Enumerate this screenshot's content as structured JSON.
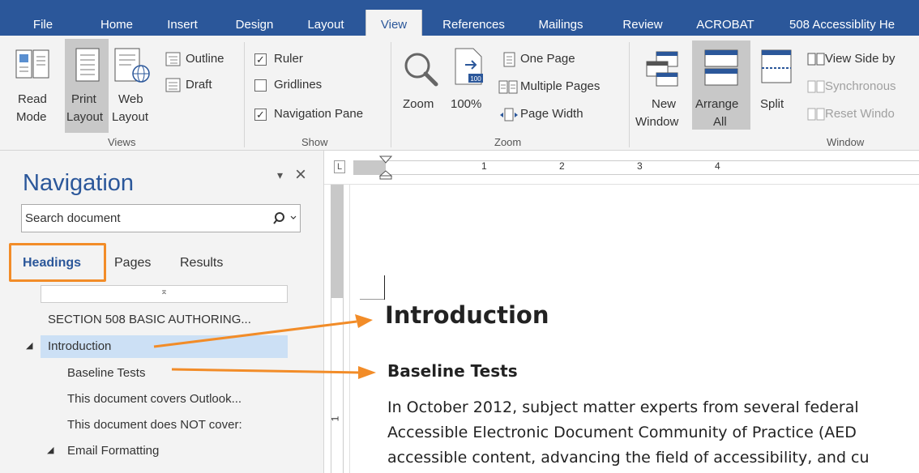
{
  "tabs": [
    "File",
    "Home",
    "Insert",
    "Design",
    "Layout",
    "View",
    "References",
    "Mailings",
    "Review",
    "ACROBAT",
    "508 Accessiblity He"
  ],
  "active_tab": "View",
  "ribbon": {
    "views": {
      "label": "Views",
      "read_mode_1": "Read",
      "read_mode_2": "Mode",
      "print_layout_1": "Print",
      "print_layout_2": "Layout",
      "web_layout_1": "Web",
      "web_layout_2": "Layout",
      "outline": "Outline",
      "draft": "Draft"
    },
    "show": {
      "label": "Show",
      "ruler": "Ruler",
      "gridlines": "Gridlines",
      "navigation_pane": "Navigation Pane",
      "ruler_checked": true,
      "gridlines_checked": false,
      "navigation_pane_checked": true
    },
    "zoom": {
      "label": "Zoom",
      "zoom": "Zoom",
      "hundred": "100%",
      "hundred_icon": "100",
      "one_page": "One Page",
      "multiple_pages": "Multiple Pages",
      "page_width": "Page Width"
    },
    "window": {
      "label": "Window",
      "new_window_1": "New",
      "new_window_2": "Window",
      "arrange_all_1": "Arrange",
      "arrange_all_2": "All",
      "split": "Split",
      "view_side_by_side": "View Side by",
      "synchronous": "Synchronous",
      "reset_window": "Reset Windo"
    }
  },
  "ruler": {
    "corner": "L",
    "numbers": [
      "1",
      "2",
      "3",
      "4"
    ],
    "left_number": "1"
  },
  "navigation": {
    "title": "Navigation",
    "close": "×",
    "dropdown": "▾",
    "search_placeholder": "Search document",
    "tabs": [
      "Headings",
      "Pages",
      "Results"
    ],
    "scroll_up": "⌅",
    "items": [
      "SECTION 508  BASIC AUTHORING...",
      "Introduction",
      "Baseline Tests",
      "This document covers Outlook...",
      "This document does NOT cover:",
      "Email Formatting"
    ]
  },
  "document": {
    "h1": "Introduction",
    "h2": "Baseline Tests",
    "lines": [
      "In October 2012, subject matter experts from several federal",
      "Accessible Electronic Document Community of Practice (AED",
      "accessible content, advancing the field of accessibility, and cu"
    ]
  },
  "colors": {
    "accent": "#2b579a",
    "highlight": "#f28c28",
    "selected": "#cce0f5"
  }
}
